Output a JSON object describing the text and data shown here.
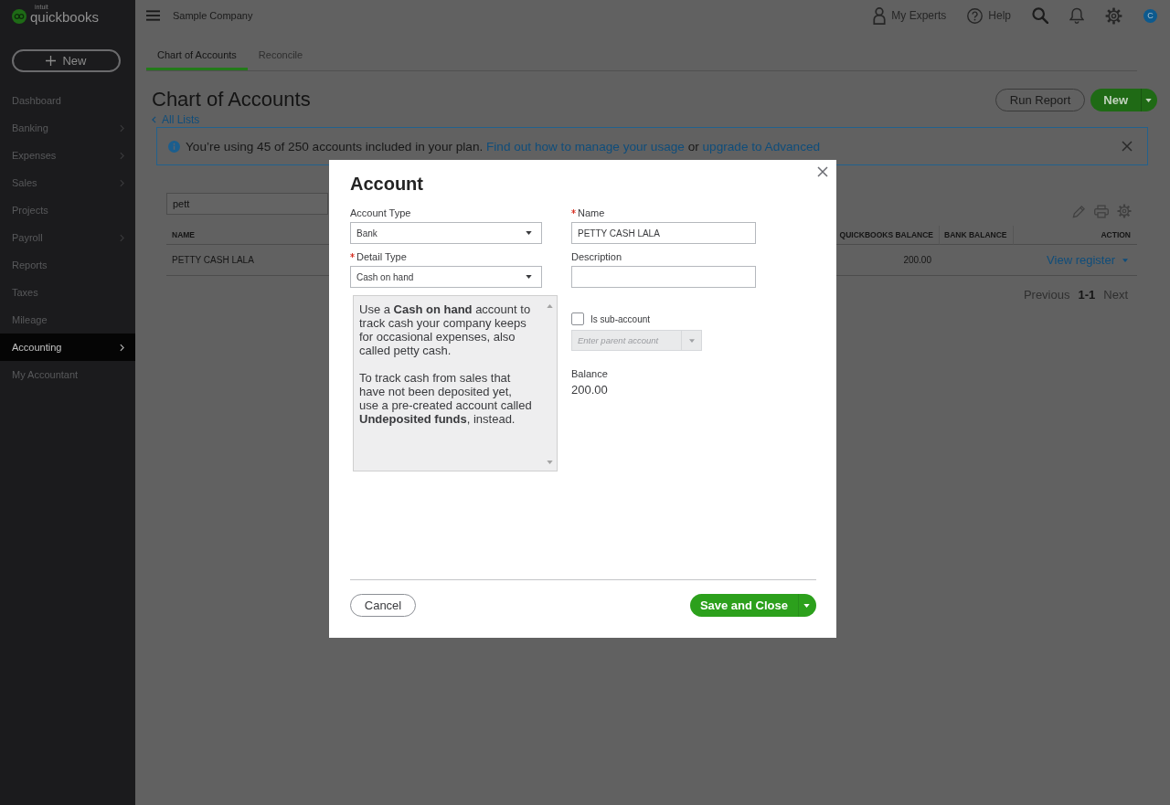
{
  "sidebar": {
    "logo": {
      "maker": "intuit",
      "product": "quickbooks"
    },
    "new_button": {
      "label": "New"
    },
    "items": [
      {
        "label": "Dashboard",
        "selected": false,
        "has_submenu": false
      },
      {
        "label": "Banking",
        "selected": false,
        "has_submenu": true
      },
      {
        "label": "Expenses",
        "selected": false,
        "has_submenu": true
      },
      {
        "label": "Sales",
        "selected": false,
        "has_submenu": true
      },
      {
        "label": "Projects",
        "selected": false,
        "has_submenu": false
      },
      {
        "label": "Payroll",
        "selected": false,
        "has_submenu": true
      },
      {
        "label": "Reports",
        "selected": false,
        "has_submenu": false
      },
      {
        "label": "Taxes",
        "selected": false,
        "has_submenu": false
      },
      {
        "label": "Mileage",
        "selected": false,
        "has_submenu": false
      },
      {
        "label": "Accounting",
        "selected": true,
        "has_submenu": true
      },
      {
        "label": "My Accountant",
        "selected": false,
        "has_submenu": false
      }
    ]
  },
  "top_bar": {
    "company": "Sample Company",
    "experts_link": "My Experts",
    "help_link": "Help",
    "avatar": {
      "initial": "C"
    }
  },
  "tabs": [
    {
      "label": "Chart of Accounts",
      "selected": true
    },
    {
      "label": "Reconcile",
      "selected": false
    }
  ],
  "page_header": {
    "title": "Chart of Accounts",
    "back_link": "All Lists",
    "run_report_button": {
      "label": "Run Report"
    },
    "new_button": {
      "label": "New"
    }
  },
  "banner": {
    "parts": [
      {
        "kind": "text",
        "text": "You’re using 45 of 250 accounts included in your plan."
      },
      {
        "kind": "link",
        "text": "Find out how to manage your usage"
      },
      {
        "kind": "text",
        "text": "or"
      },
      {
        "kind": "link",
        "text": "upgrade to Advanced"
      }
    ]
  },
  "table": {
    "search": {
      "value": "pett"
    },
    "columns": [
      {
        "label": "NAME"
      },
      {
        "label": "QUICKBOOKS BALANCE"
      },
      {
        "label": "BANK BALANCE"
      },
      {
        "label": "ACTION"
      }
    ],
    "rows": [
      {
        "name": "PETTY CASH LALA",
        "quickbooks_balance": "200.00",
        "action": "View register"
      }
    ],
    "pagination": {
      "previous": {
        "label": "Previous",
        "disabled": true
      },
      "range": "1-1",
      "next": {
        "label": "Next",
        "disabled": true
      }
    }
  },
  "dialog": {
    "title": "Account",
    "account_type": {
      "label": "Account Type",
      "required": false,
      "value": "Bank"
    },
    "detail_type": {
      "label": "Detail Type",
      "required": true,
      "value": "Cash on hand"
    },
    "detail_help": [
      "Use a **Cash on hand** account to track cash your company keeps for occasional expenses, also called petty cash.",
      "To track cash from sales that have not been deposited yet, use a pre-created account called **Undeposited funds**, instead."
    ],
    "name": {
      "label": "Name",
      "required": true,
      "value": "PETTY CASH LALA"
    },
    "description": {
      "label": "Description",
      "required": false
    },
    "sub_account": {
      "label": "Is sub-account",
      "checked": false
    },
    "parent_account": {
      "placeholder": "Enter parent account",
      "disabled": true
    },
    "balance": {
      "label": "Balance",
      "value": "200.00"
    },
    "cancel_button": {
      "label": "Cancel"
    },
    "save_button": {
      "label": "Save and Close"
    }
  }
}
